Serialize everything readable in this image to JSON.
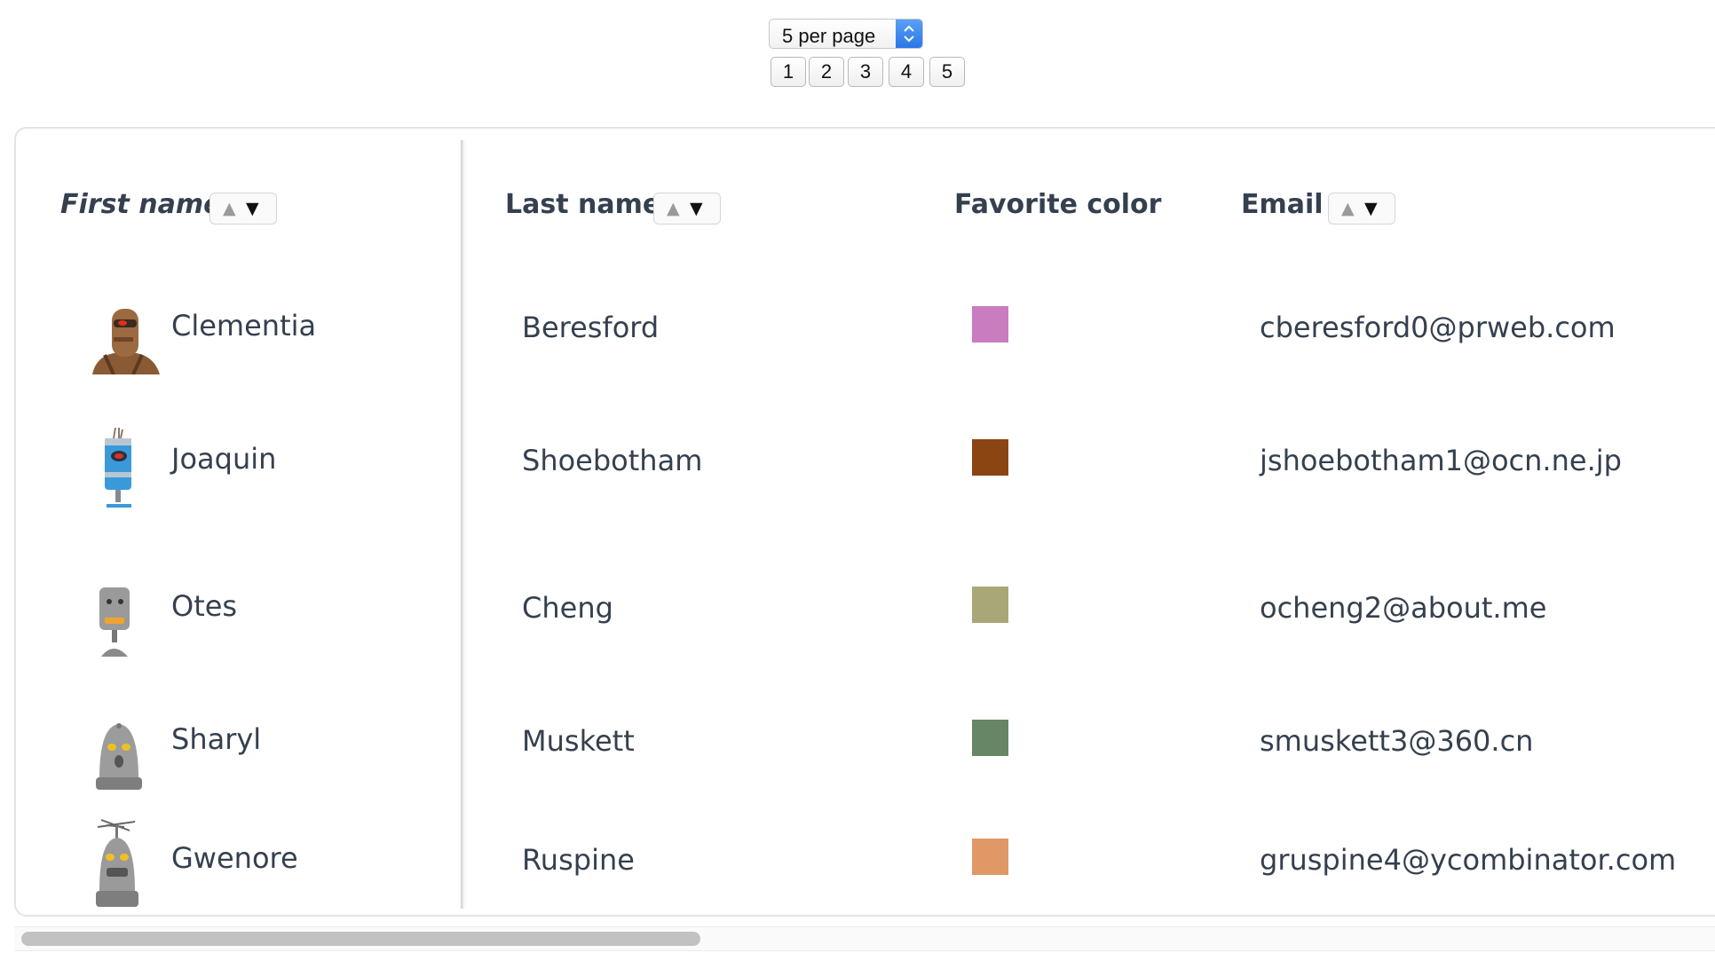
{
  "pagination": {
    "per_page_selected": "5 per page",
    "pages": [
      "1",
      "2",
      "3",
      "4",
      "5"
    ]
  },
  "table": {
    "columns": {
      "first_name": "First name",
      "last_name": "Last name",
      "favorite_color": "Favorite color",
      "email": "Email"
    },
    "sort_up_glyph": "▲",
    "sort_down_glyph": "▼",
    "rows": [
      {
        "first_name": "Clementia",
        "last_name": "Beresford",
        "color": "#c97cc0",
        "email": "cberesford0@prweb.com",
        "avatar": "brown-robot"
      },
      {
        "first_name": "Joaquin",
        "last_name": "Shoebotham",
        "color": "#8b4513",
        "email": "jshoebotham1@ocn.ne.jp",
        "avatar": "blue-robot"
      },
      {
        "first_name": "Otes",
        "last_name": "Cheng",
        "color": "#a9a778",
        "email": "ocheng2@about.me",
        "avatar": "gray-robot"
      },
      {
        "first_name": "Sharyl",
        "last_name": "Muskett",
        "color": "#668665",
        "email": "smuskett3@360.cn",
        "avatar": "gray-robot"
      },
      {
        "first_name": "Gwenore",
        "last_name": "Ruspine",
        "color": "#df9866",
        "email": "gruspine4@ycombinator.com",
        "avatar": "gray-robot"
      }
    ]
  }
}
